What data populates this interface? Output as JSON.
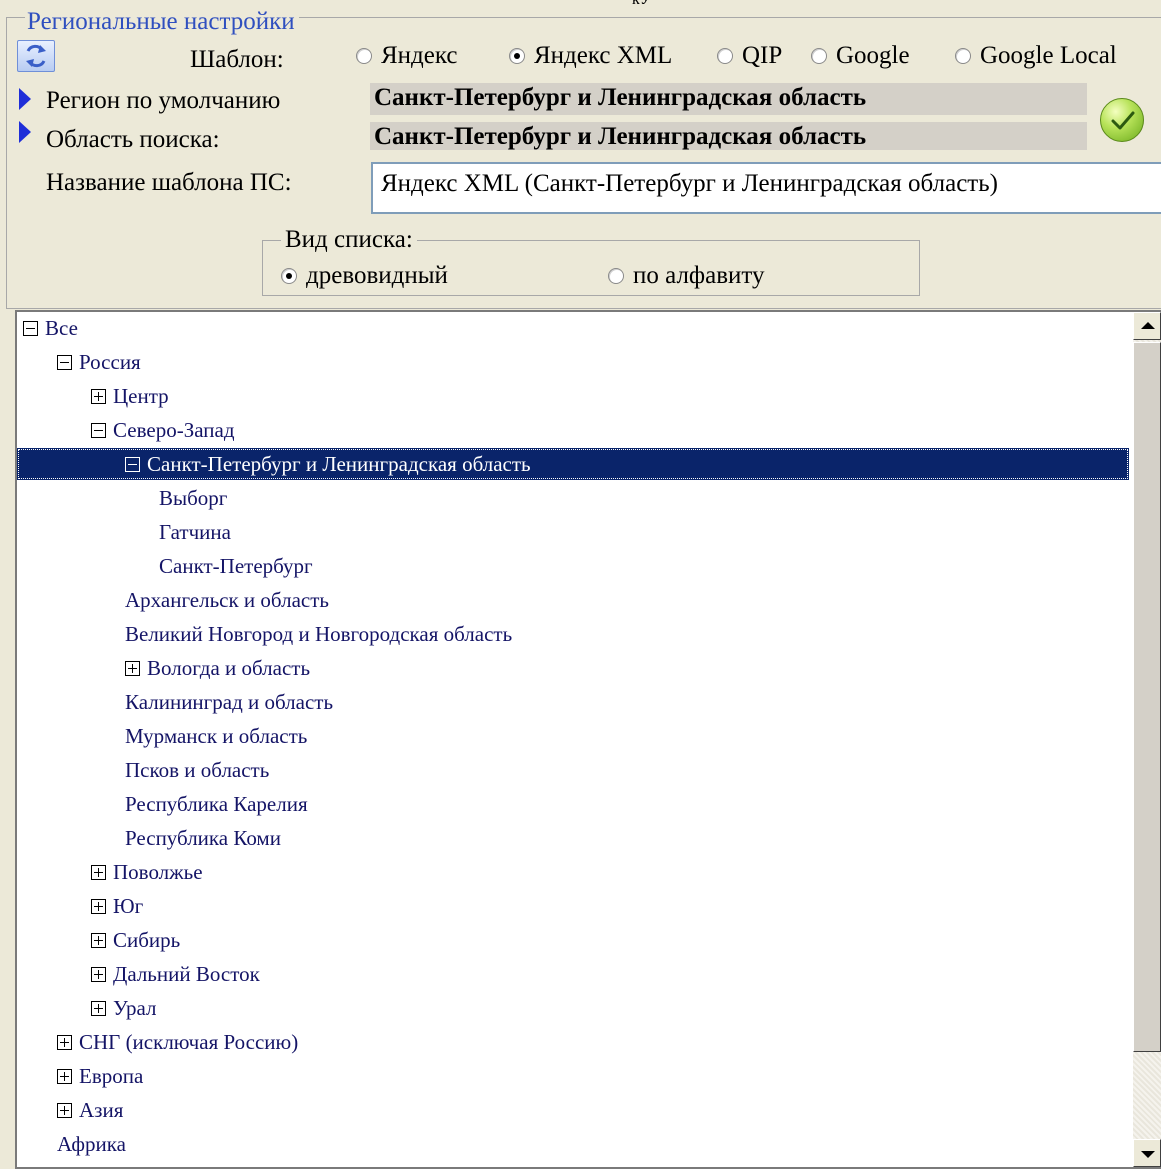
{
  "top_cut_text": "кУ",
  "settings": {
    "group_title": "Региональные настройки",
    "template_label": "Шаблон:",
    "templates": [
      {
        "label": "Яндекс",
        "checked": false
      },
      {
        "label": "Яндекс XML",
        "checked": true
      },
      {
        "label": "QIP",
        "checked": false
      },
      {
        "label": "Google",
        "checked": false
      },
      {
        "label": "Google Local",
        "checked": false
      }
    ],
    "default_region_label": "Регион по умолчанию",
    "default_region_value": "Санкт-Петербург и Ленинградская область",
    "search_area_label": "Область поиска:",
    "search_area_value": "Санкт-Петербург и Ленинградская область",
    "template_name_label": "Название шаблона ПС:",
    "template_name_value": "Яндекс XML (Санкт-Петербург и Ленинградская область)",
    "view_group_title": "Вид списка:",
    "view_options": [
      {
        "label": "древовидный",
        "checked": true
      },
      {
        "label": "по алфавиту",
        "checked": false
      }
    ]
  },
  "tree": {
    "rows": [
      {
        "label": "Все",
        "level": 0,
        "expander": "minus"
      },
      {
        "label": "Россия",
        "level": 1,
        "expander": "minus"
      },
      {
        "label": "Центр",
        "level": 2,
        "expander": "plus"
      },
      {
        "label": "Северо-Запад",
        "level": 2,
        "expander": "minus"
      },
      {
        "label": "Санкт-Петербург и Ленинградская область",
        "level": 3,
        "expander": "minus",
        "selected": true
      },
      {
        "label": "Выборг",
        "level": 4,
        "expander": "none"
      },
      {
        "label": "Гатчина",
        "level": 4,
        "expander": "none"
      },
      {
        "label": "Санкт-Петербург",
        "level": 4,
        "expander": "none"
      },
      {
        "label": "Архангельск и область",
        "level": 3,
        "expander": "none"
      },
      {
        "label": "Великий Новгород и Новгородская область",
        "level": 3,
        "expander": "none"
      },
      {
        "label": "Вологда и область",
        "level": 3,
        "expander": "plus"
      },
      {
        "label": "Калининград и область",
        "level": 3,
        "expander": "none"
      },
      {
        "label": "Мурманск и область",
        "level": 3,
        "expander": "none"
      },
      {
        "label": "Псков и область",
        "level": 3,
        "expander": "none"
      },
      {
        "label": "Республика Карелия",
        "level": 3,
        "expander": "none"
      },
      {
        "label": "Республика Коми",
        "level": 3,
        "expander": "none"
      },
      {
        "label": "Поволжье",
        "level": 2,
        "expander": "plus"
      },
      {
        "label": "Юг",
        "level": 2,
        "expander": "plus"
      },
      {
        "label": "Сибирь",
        "level": 2,
        "expander": "plus"
      },
      {
        "label": "Дальний Восток",
        "level": 2,
        "expander": "plus"
      },
      {
        "label": "Урал",
        "level": 2,
        "expander": "plus"
      },
      {
        "label": "СНГ (исключая Россию)",
        "level": 1,
        "expander": "plus"
      },
      {
        "label": "Европа",
        "level": 1,
        "expander": "plus"
      },
      {
        "label": "Азия",
        "level": 1,
        "expander": "plus"
      },
      {
        "label": "Африка",
        "level": 1,
        "expander": "none"
      }
    ]
  }
}
